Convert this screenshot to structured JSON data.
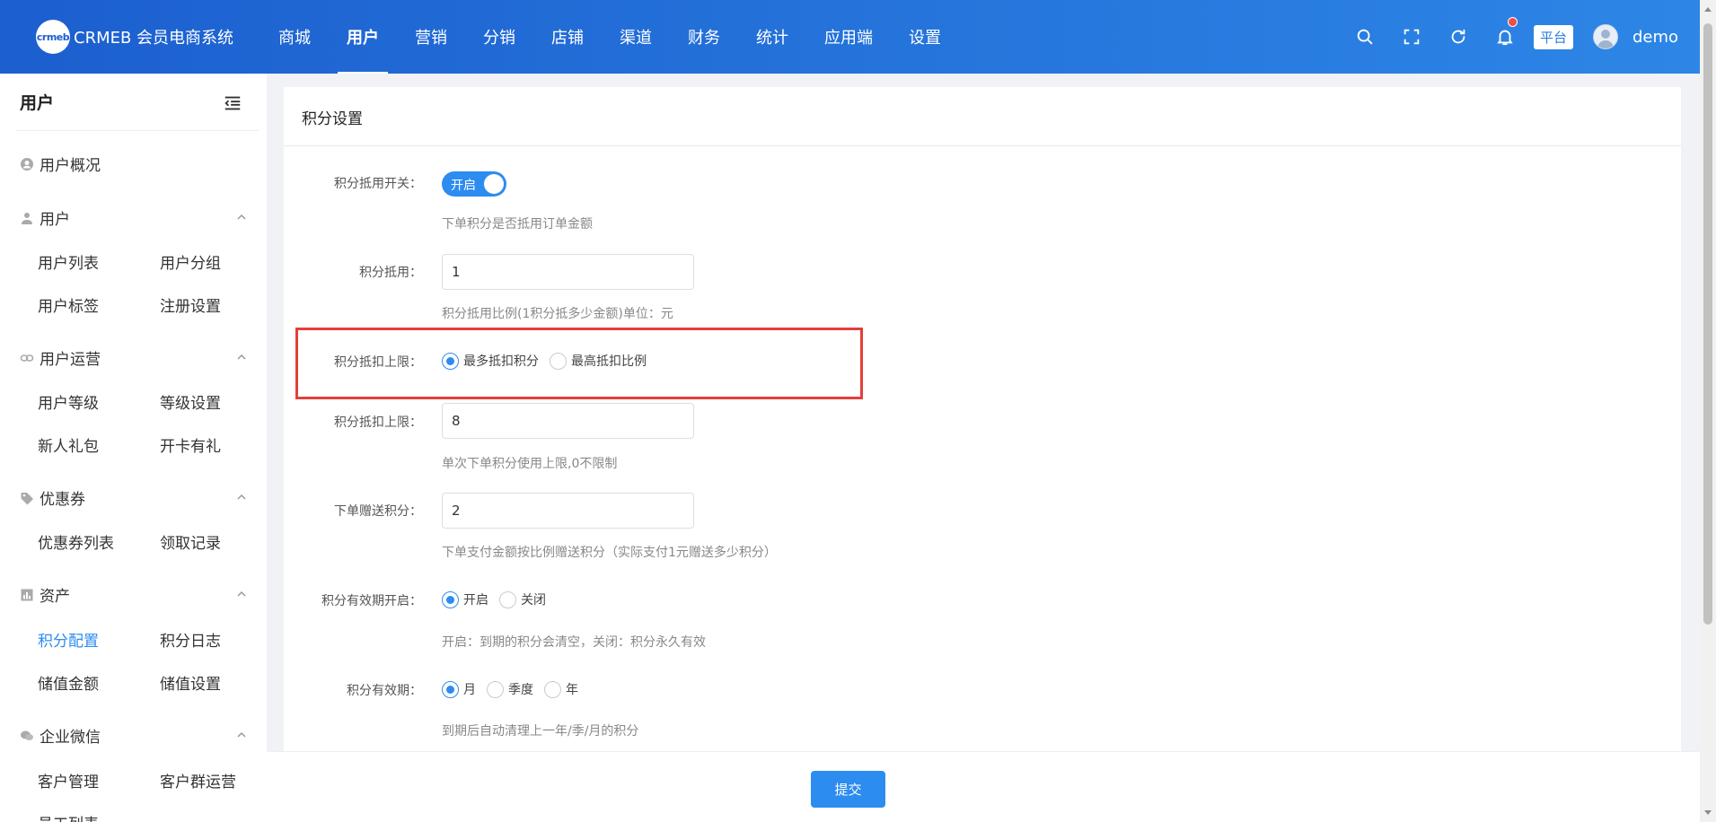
{
  "header": {
    "logo_badge": "crmeb",
    "brand": "CRMEB 会员电商系统",
    "nav": [
      "商城",
      "用户",
      "营销",
      "分销",
      "店铺",
      "渠道",
      "财务",
      "统计",
      "应用端",
      "设置"
    ],
    "active_nav": "用户",
    "platform_tag": "平台",
    "username": "demo",
    "icons": [
      "search-icon",
      "fullscreen-icon",
      "refresh-icon",
      "bell-icon"
    ]
  },
  "sidebar": {
    "title": "用户",
    "overview": "用户概况",
    "groups": {
      "user": {
        "label": "用户",
        "items": [
          "用户列表",
          "用户分组",
          "用户标签",
          "注册设置"
        ]
      },
      "ops": {
        "label": "用户运营",
        "items": [
          "用户等级",
          "等级设置",
          "新人礼包",
          "开卡有礼"
        ]
      },
      "coupon": {
        "label": "优惠券",
        "items": [
          "优惠券列表",
          "领取记录"
        ]
      },
      "assets": {
        "label": "资产",
        "items": [
          "积分配置",
          "积分日志",
          "储值金额",
          "储值设置"
        ],
        "active": "积分配置"
      },
      "wecom": {
        "label": "企业微信",
        "items": [
          "客户管理",
          "客户群运营",
          "员工列表"
        ]
      }
    }
  },
  "panel": {
    "title": "积分设置",
    "form": {
      "switch_label": "积分抵用开关：",
      "switch_text": "开启",
      "switch_on": true,
      "switch_help": "下单积分是否抵用订单金额",
      "deduct_label": "积分抵用：",
      "deduct_value": "1",
      "deduct_help": "积分抵用比例(1积分抵多少金额)单位：元",
      "limit_type_label": "积分抵扣上限：",
      "limit_type_options": [
        "最多抵扣积分",
        "最高抵扣比例"
      ],
      "limit_type_selected": "最多抵扣积分",
      "limit_label": "积分抵扣上限：",
      "limit_value": "8",
      "limit_help": "单次下单积分使用上限,0不限制",
      "gift_label": "下单赠送积分：",
      "gift_value": "2",
      "gift_help": "下单支付金额按比例赠送积分（实际支付1元赠送多少积分）",
      "expire_switch_label": "积分有效期开启：",
      "expire_switch_options": [
        "开启",
        "关闭"
      ],
      "expire_switch_selected": "开启",
      "expire_switch_help": "开启：到期的积分会清空，关闭：积分永久有效",
      "expire_period_label": "积分有效期：",
      "expire_period_options": [
        "月",
        "季度",
        "年"
      ],
      "expire_period_selected": "月",
      "expire_period_help": "到期后自动清理上一年/季/月的积分"
    },
    "submit_label": "提交"
  },
  "colors": {
    "primary": "#2d8cf0",
    "header_start": "#1c5fcf",
    "header_end": "#2d86e6",
    "highlight": "#e2403a"
  }
}
